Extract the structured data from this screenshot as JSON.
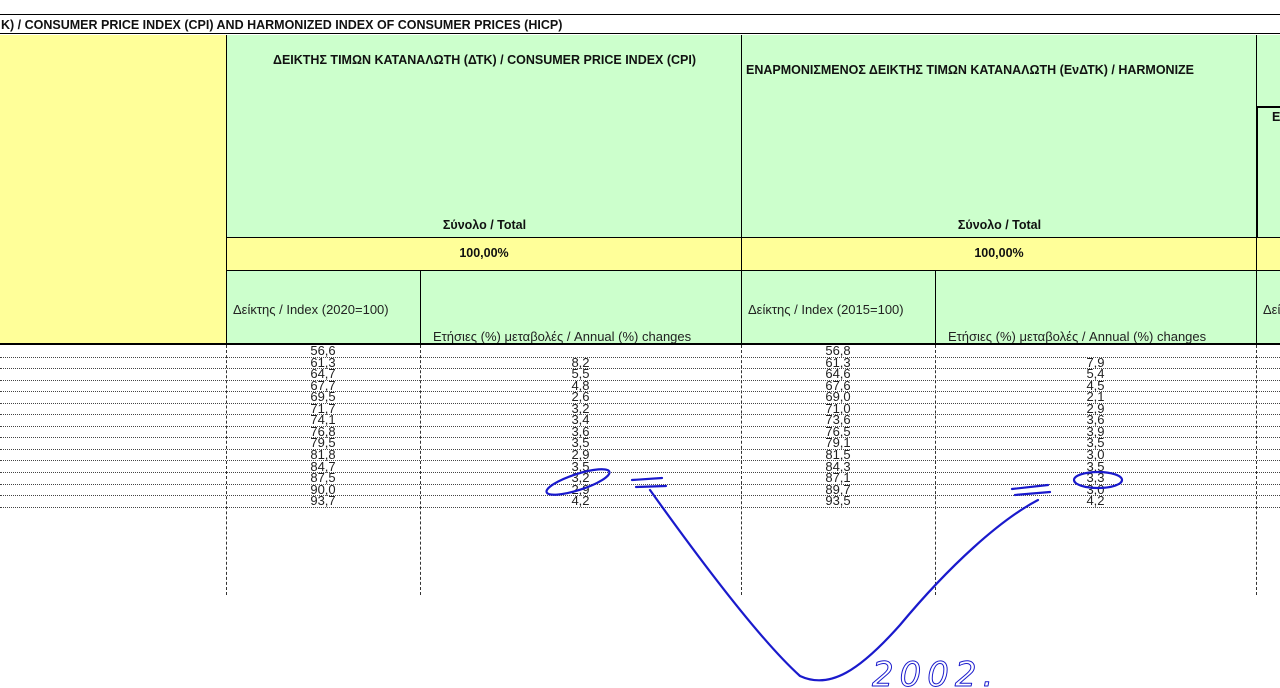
{
  "title": "K) / CONSUMER PRICE INDEX (CPI) AND HARMONIZED INDEX OF CONSUMER PRICES (HICP)",
  "cpi": {
    "header": "ΔΕΙΚΤΗΣ ΤΙΜΩΝ ΚΑΤΑΝΑΛΩΤΗ  (ΔΤΚ) / CONSUMER PRICE INDEX (CPI)",
    "total": "Σύνολο / Total",
    "weight": "100,00%",
    "index_label": "Δείκτης / Index (2020=100)",
    "change_label": "Ετήσιες (%) μεταβολές / Annual (%) changes"
  },
  "hicp": {
    "header": "ΕΝΑΡΜΟΝΙΣΜΕΝΟΣ ΔΕΙΚΤΗΣ ΤΙΜΩΝ ΚΑΤΑΝΑΛΩΤΗ (ΕνΔΤΚ) / HARMONIZE",
    "total": "Σύνολο / Total",
    "weight": "100,00%",
    "index_label": "Δείκτης / Index (2015=100)",
    "change_label": "Ετήσιες (%) μεταβολές / Annual (%) changes",
    "next_header_fragment": "E",
    "next_index_fragment": "Δεί"
  },
  "rows": [
    {
      "cpi_index": "56,6",
      "cpi_change": "",
      "hicp_index": "56,8",
      "hicp_change": ""
    },
    {
      "cpi_index": "61,3",
      "cpi_change": "8,2",
      "hicp_index": "61,3",
      "hicp_change": "7,9"
    },
    {
      "cpi_index": "64,7",
      "cpi_change": "5,5",
      "hicp_index": "64,6",
      "hicp_change": "5,4"
    },
    {
      "cpi_index": "67,7",
      "cpi_change": "4,8",
      "hicp_index": "67,6",
      "hicp_change": "4,5"
    },
    {
      "cpi_index": "69,5",
      "cpi_change": "2,6",
      "hicp_index": "69,0",
      "hicp_change": "2,1"
    },
    {
      "cpi_index": "71,7",
      "cpi_change": "3,2",
      "hicp_index": "71,0",
      "hicp_change": "2,9"
    },
    {
      "cpi_index": "74,1",
      "cpi_change": "3,4",
      "hicp_index": "73,6",
      "hicp_change": "3,6"
    },
    {
      "cpi_index": "76,8",
      "cpi_change": "3,6",
      "hicp_index": "76,5",
      "hicp_change": "3,9"
    },
    {
      "cpi_index": "79,5",
      "cpi_change": "3,5",
      "hicp_index": "79,1",
      "hicp_change": "3,5"
    },
    {
      "cpi_index": "81,8",
      "cpi_change": "2,9",
      "hicp_index": "81,5",
      "hicp_change": "3,0"
    },
    {
      "cpi_index": "84,7",
      "cpi_change": "3,5",
      "hicp_index": "84,3",
      "hicp_change": "3,5"
    },
    {
      "cpi_index": "87,5",
      "cpi_change": "3,2",
      "hicp_index": "87,1",
      "hicp_change": "3,3"
    },
    {
      "cpi_index": "90,0",
      "cpi_change": "2,9",
      "hicp_index": "89,7",
      "hicp_change": "3,0"
    },
    {
      "cpi_index": "93,7",
      "cpi_change": "4,2",
      "hicp_index": "93,5",
      "hicp_change": "4,2"
    }
  ],
  "annotation": {
    "handwritten_text": "2002.",
    "ink_color": "#1a1acc"
  }
}
